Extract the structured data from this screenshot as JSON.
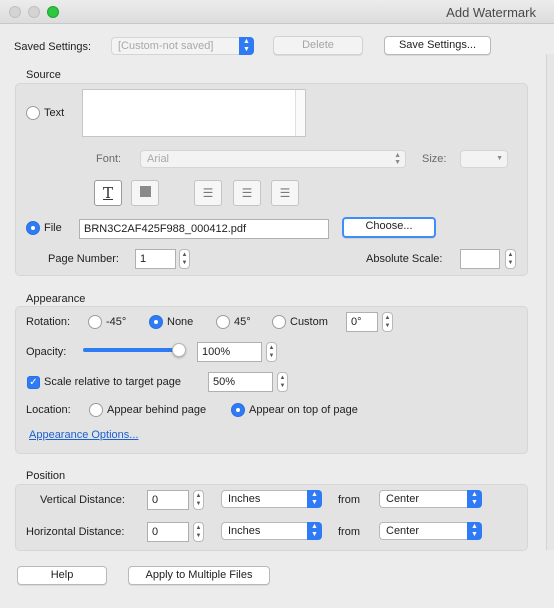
{
  "window": {
    "title": "Add Watermark"
  },
  "saved_settings": {
    "label": "Saved Settings:",
    "value": "[Custom-not saved]",
    "delete_label": "Delete",
    "save_label": "Save Settings..."
  },
  "source": {
    "title": "Source",
    "text_label": "Text",
    "font_label": "Font:",
    "font_value": "Arial",
    "size_label": "Size:",
    "size_value": "",
    "file_label": "File",
    "file_value": "BRN3C2AF425F988_000412.pdf",
    "choose_label": "Choose...",
    "page_number_label": "Page Number:",
    "page_number_value": "1",
    "absolute_scale_label": "Absolute Scale:",
    "absolute_scale_value": "",
    "tools": [
      "text-style-icon",
      "fill-square-icon",
      "align-left-icon",
      "align-center-icon",
      "align-right-icon"
    ]
  },
  "appearance": {
    "title": "Appearance",
    "rotation_label": "Rotation:",
    "rotation_options": [
      "-45°",
      "None",
      "45°",
      "Custom"
    ],
    "rotation_selected": "None",
    "rotation_custom_value": "0°",
    "opacity_label": "Opacity:",
    "opacity_value": "100%",
    "opacity_fraction": 1.0,
    "scale_label": "Scale relative to target page",
    "scale_checked": true,
    "scale_value": "50%",
    "location_label": "Location:",
    "location_behind": "Appear behind page",
    "location_top": "Appear on top of page",
    "location_selected": "Appear on top of page",
    "options_link": "Appearance Options..."
  },
  "position": {
    "title": "Position",
    "vertical_label": "Vertical Distance:",
    "vertical_value": "0",
    "vertical_unit": "Inches",
    "vertical_from_label": "from",
    "vertical_from": "Center",
    "horizontal_label": "Horizontal Distance:",
    "horizontal_value": "0",
    "horizontal_unit": "Inches",
    "horizontal_from_label": "from",
    "horizontal_from": "Center"
  },
  "footer": {
    "help_label": "Help",
    "apply_multiple_label": "Apply to Multiple Files"
  },
  "colors": {
    "accent": "#2f7bf5",
    "link": "#1a5fd3"
  }
}
